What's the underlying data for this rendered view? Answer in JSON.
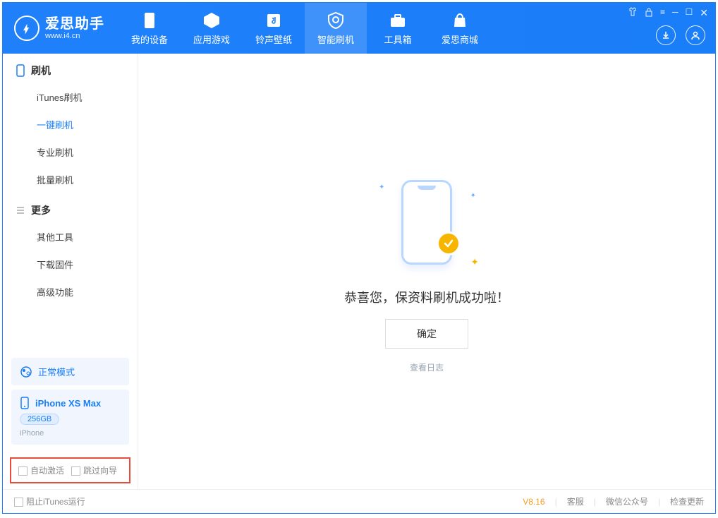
{
  "logo": {
    "main": "爱思助手",
    "sub": "www.i4.cn"
  },
  "nav": {
    "device": "我的设备",
    "apps": "应用游戏",
    "ringtones": "铃声壁纸",
    "flash": "智能刷机",
    "toolbox": "工具箱",
    "store": "爱思商城"
  },
  "sidebar": {
    "flash_section": "刷机",
    "items_flash": {
      "itunes": "iTunes刷机",
      "oneclick": "一键刷机",
      "pro": "专业刷机",
      "batch": "批量刷机"
    },
    "more_section": "更多",
    "items_more": {
      "other": "其他工具",
      "firmware": "下载固件",
      "advanced": "高级功能"
    },
    "mode_label": "正常模式",
    "device": {
      "name": "iPhone XS Max",
      "storage": "256GB",
      "type": "iPhone"
    }
  },
  "options": {
    "auto_activate": "自动激活",
    "skip_guide": "跳过向导"
  },
  "main": {
    "success_text": "恭喜您，保资料刷机成功啦！",
    "confirm": "确定",
    "view_log": "查看日志"
  },
  "statusbar": {
    "block_itunes": "阻止iTunes运行",
    "version": "V8.16",
    "support": "客服",
    "wechat": "微信公众号",
    "update": "检查更新"
  }
}
